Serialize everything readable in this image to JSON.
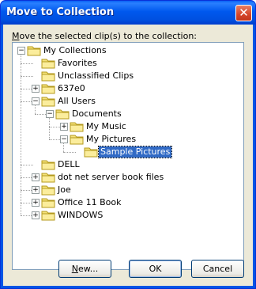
{
  "window": {
    "title": "Move to Collection",
    "close_glyph": "✕"
  },
  "prompt": {
    "prefix": "M",
    "rest": "ove the selected clip(s) to the collection:"
  },
  "tree": [
    {
      "label": "My Collections",
      "level": 0,
      "expander": "−",
      "selected": false
    },
    {
      "label": "Favorites",
      "level": 1,
      "expander": "",
      "selected": false
    },
    {
      "label": "Unclassified Clips",
      "level": 1,
      "expander": "",
      "selected": false
    },
    {
      "label": "637e0",
      "level": 1,
      "expander": "+",
      "selected": false
    },
    {
      "label": "All Users",
      "level": 1,
      "expander": "−",
      "selected": false
    },
    {
      "label": "Documents",
      "level": 2,
      "expander": "−",
      "selected": false
    },
    {
      "label": "My Music",
      "level": 3,
      "expander": "+",
      "selected": false
    },
    {
      "label": "My Pictures",
      "level": 3,
      "expander": "−",
      "selected": false
    },
    {
      "label": "Sample Pictures",
      "level": 4,
      "expander": "",
      "selected": true
    },
    {
      "label": "DELL",
      "level": 1,
      "expander": "",
      "selected": false
    },
    {
      "label": "dot net server book files",
      "level": 1,
      "expander": "+",
      "selected": false
    },
    {
      "label": "Joe",
      "level": 1,
      "expander": "+",
      "selected": false
    },
    {
      "label": "Office 11 Book",
      "level": 1,
      "expander": "+",
      "selected": false
    },
    {
      "label": "WINDOWS",
      "level": 1,
      "expander": "+",
      "selected": false
    }
  ],
  "buttons": {
    "new_label": "New...",
    "ok_label": "OK",
    "cancel_label": "Cancel"
  },
  "colors": {
    "titlebar": "#0058ee",
    "selection": "#316ac5",
    "dialog_bg": "#ece9d8",
    "folder": "#f5e27a"
  },
  "icons": {
    "folder": "folder-icon",
    "expand": "plus-icon",
    "collapse": "minus-icon"
  }
}
